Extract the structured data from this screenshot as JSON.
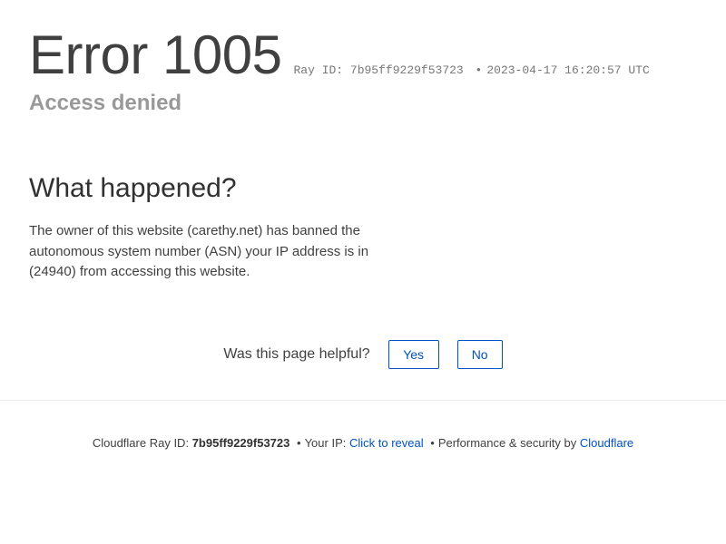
{
  "header": {
    "title": "Error 1005",
    "ray_label": "Ray ID:",
    "ray_id": "7b95ff9229f53723",
    "bullet": "•",
    "timestamp": "2023-04-17 16:20:57 UTC",
    "subtitle": "Access denied"
  },
  "main": {
    "heading": "What happened?",
    "description": "The owner of this website (carethy.net) has banned the autonomous system number (ASN) your IP address is in (24940) from accessing this website."
  },
  "feedback": {
    "question": "Was this page helpful?",
    "yes_label": "Yes",
    "no_label": "No"
  },
  "footer": {
    "ray_prefix": "Cloudflare Ray ID:",
    "ray_id": "7b95ff9229f53723",
    "bullet": "•",
    "ip_label": "Your IP:",
    "ip_link": "Click to reveal",
    "perf_text": "Performance & security by",
    "cloudflare_link": "Cloudflare"
  },
  "colors": {
    "text": "#404040",
    "muted": "#999999",
    "link": "#0051c3"
  }
}
